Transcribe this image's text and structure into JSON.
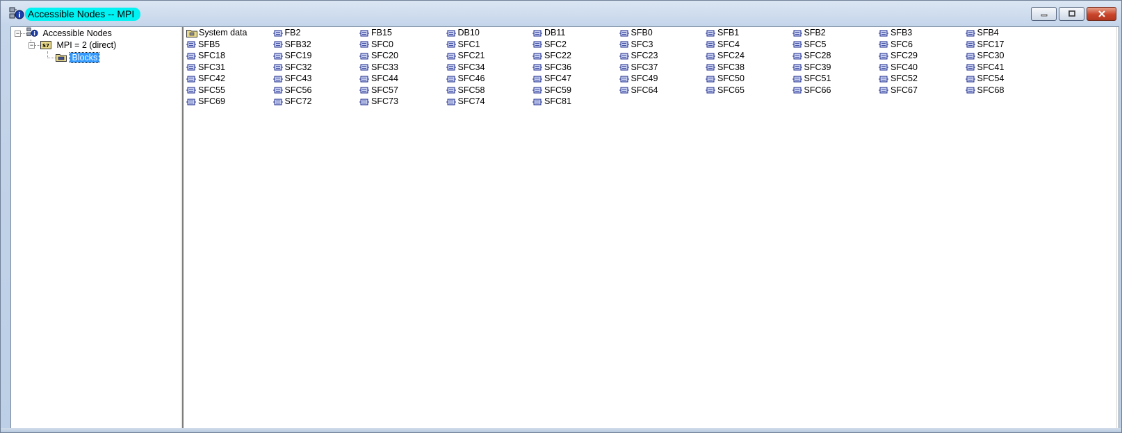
{
  "window": {
    "title": "Accessible Nodes -- MPI",
    "title_highlight_color": "#00f2f2",
    "controls": [
      "minimize",
      "maximize",
      "close"
    ]
  },
  "tree": {
    "root": {
      "label": "Accessible Nodes",
      "icon": "network-nodes-icon"
    },
    "node": {
      "label": "MPI =   2 (direct)",
      "icon": "s7-station-icon"
    },
    "leaf": {
      "label": "Blocks",
      "icon": "blocks-folder-icon",
      "selected": true
    }
  },
  "blocks": [
    "System data",
    "FB2",
    "FB15",
    "DB10",
    "DB11",
    "SFB0",
    "SFB1",
    "SFB2",
    "SFB3",
    "SFB4",
    "SFB5",
    "SFB32",
    "SFC0",
    "SFC1",
    "SFC2",
    "SFC3",
    "SFC4",
    "SFC5",
    "SFC6",
    "SFC17",
    "SFC18",
    "SFC19",
    "SFC20",
    "SFC21",
    "SFC22",
    "SFC23",
    "SFC24",
    "SFC28",
    "SFC29",
    "SFC30",
    "SFC31",
    "SFC32",
    "SFC33",
    "SFC34",
    "SFC36",
    "SFC37",
    "SFC38",
    "SFC39",
    "SFC40",
    "SFC41",
    "SFC42",
    "SFC43",
    "SFC44",
    "SFC46",
    "SFC47",
    "SFC49",
    "SFC50",
    "SFC51",
    "SFC52",
    "SFC54",
    "SFC55",
    "SFC56",
    "SFC57",
    "SFC58",
    "SFC59",
    "SFC64",
    "SFC65",
    "SFC66",
    "SFC67",
    "SFC68",
    "SFC69",
    "SFC72",
    "SFC73",
    "SFC74",
    "SFC81"
  ],
  "selection_color": "#3399ff"
}
